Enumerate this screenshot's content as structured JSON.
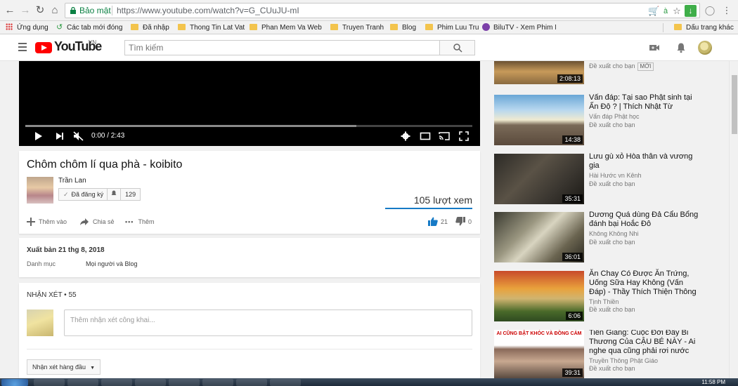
{
  "browser": {
    "secure_label": "Bảo mật",
    "url": "https://www.youtube.com/watch?v=G_CUuJU-mI",
    "bookmarks": [
      {
        "label": "Ứng dụng",
        "icon": "apps-grid-icon"
      },
      {
        "label": "Các tab mới đóng",
        "icon": "recent-tabs-icon"
      },
      {
        "label": "Đã nhập",
        "icon": "folder-icon"
      },
      {
        "label": "Thong Tin Lat Vat",
        "icon": "folder-icon"
      },
      {
        "label": "Phan Mem Va Web",
        "icon": "folder-icon"
      },
      {
        "label": "Truyen Tranh",
        "icon": "folder-icon"
      },
      {
        "label": "Blog",
        "icon": "folder-icon"
      },
      {
        "label": "Phim Luu Tru",
        "icon": "folder-icon"
      },
      {
        "label": "BiluTV - Xem Phim N",
        "icon": "film-reel-icon"
      },
      {
        "label": "Dấu trang khác",
        "icon": "folder-icon"
      }
    ]
  },
  "masthead": {
    "logo_text": "YouTube",
    "country_code": "VN",
    "search_placeholder": "Tìm kiếm"
  },
  "player": {
    "time": "0:00 / 2:43",
    "buffered_fraction": 0.74
  },
  "video": {
    "title": "Chôm chôm lí qua phà - koibito",
    "channel": "Trần Lan",
    "subscribed_label": "Đã đăng ký",
    "subscriber_count": "129",
    "views": "105 lượt xem",
    "actions": {
      "add": "Thêm vào",
      "share": "Chia sẻ",
      "more": "Thêm"
    },
    "likes": "21",
    "dislikes": "0",
    "like_fraction": 1.0
  },
  "description": {
    "published": "Xuất bản 21 thg 8, 2018",
    "category_label": "Danh mục",
    "category_value": "Mọi người và Blog"
  },
  "comments": {
    "header": "NHẬN XÉT • 55",
    "input_placeholder": "Thêm nhận xét công khai...",
    "sort_label": "Nhận xét hàng đầu"
  },
  "sidebar": {
    "recommended_label": "Đề xuất cho bạn",
    "new_badge": "MỚI",
    "items": [
      {
        "title": "",
        "channel": "",
        "duration": "2:08:13",
        "has_new_badge": true
      },
      {
        "title": "Vấn đáp: Tại sao Phật sinh tại Ấn Độ ? | Thích Nhật Từ",
        "channel": "Vấn đáp Phật học",
        "duration": "14:38"
      },
      {
        "title": "Lưu gù xỏ Hòa thân và vương gia",
        "channel": "Hài Hước vn Kênh",
        "duration": "35:31"
      },
      {
        "title": "Dương Quá dùng Đả Cẩu Bổng đánh bại Hoắc Đô",
        "channel": "Không Không Nhi",
        "duration": "36:01"
      },
      {
        "title": "Ăn Chay Có Được Ăn Trứng, Uống Sữa Hay Không (Vấn Đáp) - Thầy Thích Thiện Thông",
        "channel": "Tịnh Thiền",
        "duration": "6:06"
      },
      {
        "title": "Tiền Giang: Cuộc Đời Đầy Bi Thương Của CẬU BÉ NÀY - Ai nghe qua cũng phải rơi nước",
        "channel": "Truyền Thông Phật Giáo",
        "duration": "39:31",
        "thumb_caption": "AI CŨNG BẬT KHÓC VÀ ĐỒNG CẢM"
      }
    ]
  },
  "taskbar": {
    "clock": "11:58 PM"
  }
}
